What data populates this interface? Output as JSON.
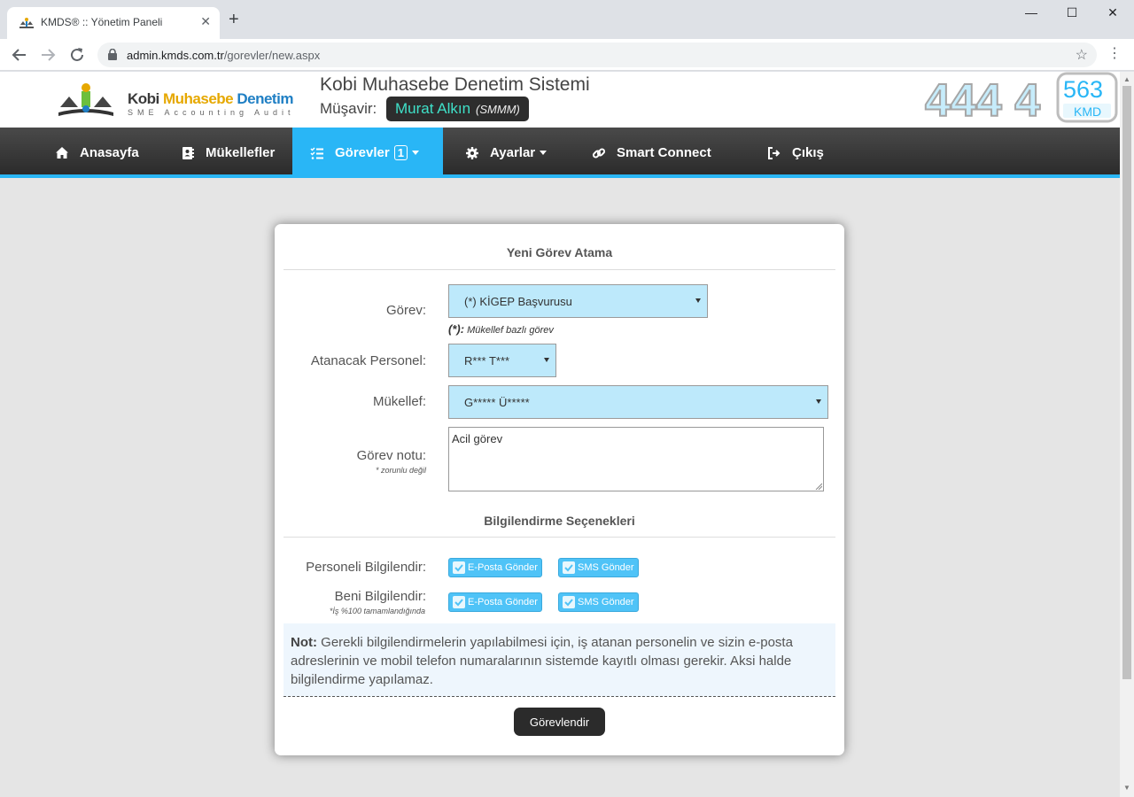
{
  "browser": {
    "tab_title": "KMDS® :: Yönetim Paneli",
    "tab_close": "✕",
    "new_tab": "+",
    "url_domain": "admin.kmds.com.tr",
    "url_path": "/gorevler/new.aspx",
    "minimize": "—",
    "maximize": "☐",
    "close": "✕"
  },
  "header": {
    "logo_kobi": "Kobi ",
    "logo_muhasebe": "Muhasebe ",
    "logo_denetim": "Denetim",
    "logo_sub": "SME Accounting Audit",
    "system_title": "Kobi Muhasebe Denetim Sistemi",
    "musavir_label": "Müşavir:",
    "musavir_name": "Murat Alkın",
    "musavir_title": "(SMMM)",
    "phone_main": "444 4",
    "phone_suffix": "563",
    "phone_kmd": "KMD"
  },
  "nav": {
    "home": "Anasayfa",
    "clients": "Mükellefler",
    "tasks": "Görevler",
    "tasks_badge": "1",
    "settings": "Ayarlar",
    "smart_connect": "Smart Connect",
    "logout": "Çıkış"
  },
  "form": {
    "title": "Yeni Görev Atama",
    "task_label": "Görev:",
    "task_value": "(*) KİGEP Başvurusu",
    "task_hint_mark": "(*):",
    "task_hint": " Mükellef bazlı görev",
    "staff_label": "Atanacak Personel:",
    "staff_value": "R*** T***",
    "client_label": "Mükellef:",
    "client_value": "G***** Ü*****",
    "note_label": "Görev notu:",
    "note_sublabel": "* zorunlu değil",
    "note_value": "Acil görev",
    "notify_title": "Bilgilendirme Seçenekleri",
    "notify_staff_label": "Personeli Bilgilendir:",
    "notify_me_label": "Beni Bilgilendir:",
    "notify_me_sublabel": "*İş %100 tamamlandığında",
    "email_option": "E-Posta Gönder",
    "sms_option": "SMS Gönder",
    "info_bold": "Not:",
    "info_text": " Gerekli bilgilendirmelerin yapılabilmesi için, iş atanan personelin ve sizin e-posta adreslerinin ve mobil telefon numaralarının sistemde kayıtlı olması gerekir. Aksi halde bilgilendirme yapılamaz.",
    "submit": "Görevlendir"
  },
  "colors": {
    "accent": "#29b6f6",
    "navbar": "#333333",
    "select_bg": "#bde9fb",
    "musavir_name": "#3fe0c8"
  }
}
